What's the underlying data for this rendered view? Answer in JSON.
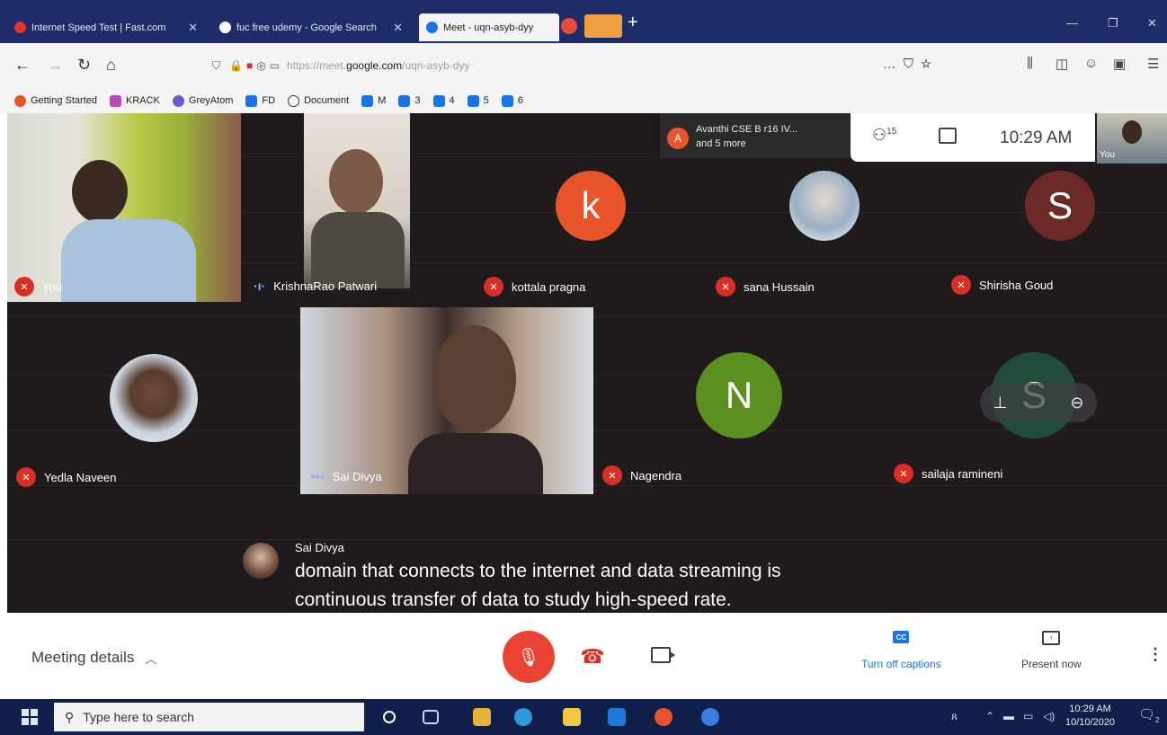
{
  "browser": {
    "tabs": [
      {
        "title": "Internet Speed Test | Fast.com",
        "active": false
      },
      {
        "title": "fuc free udemy - Google Search",
        "active": false
      },
      {
        "title": "Meet - uqn-asyb-dyy",
        "active": true
      }
    ],
    "url": {
      "protocol": "https://meet.",
      "host": "google.com",
      "path": "/uqn-asyb-dyy"
    },
    "bookmarks": [
      "Getting Started",
      "KRACK",
      "GreyAtom",
      "FD",
      "Document",
      "M",
      "3",
      "4",
      "5",
      "6"
    ]
  },
  "meet": {
    "presenter_chip": {
      "avatar_letter": "A",
      "name": "Avanthi CSE B r16 IV...",
      "more": "and 5 more"
    },
    "people_count": "15",
    "clock": "10:29 AM",
    "self_thumb_label": "You",
    "participants": [
      {
        "name": "You",
        "muted": true
      },
      {
        "name": "KrishnaRao Patwari",
        "muted": false
      },
      {
        "name": "kottala pragna",
        "muted": true,
        "avatar_letter": "k",
        "avatar_color": "#e8552b"
      },
      {
        "name": "sana Hussain",
        "muted": true
      },
      {
        "name": "Shirisha Goud",
        "muted": true,
        "avatar_letter": "S",
        "avatar_color": "#6b2a26"
      },
      {
        "name": "Yedla Naveen",
        "muted": true
      },
      {
        "name": "Sai Divya",
        "muted": false
      },
      {
        "name": "Nagendra",
        "muted": true,
        "avatar_letter": "N",
        "avatar_color": "#5b8f1f"
      },
      {
        "name": "sailaja ramineni",
        "muted": true,
        "avatar_letter": "S",
        "avatar_color": "#1f4d3a"
      }
    ],
    "caption": {
      "speaker": "Sai Divya",
      "line1": "domain that connects to the internet and data streaming is",
      "line2": "continuous transfer of data to study high-speed rate."
    },
    "bottom_bar": {
      "meeting_details": "Meeting details",
      "captions_label": "Turn off captions",
      "present_label": "Present now"
    }
  },
  "taskbar": {
    "search_placeholder": "Type here to search",
    "time": "10:29 AM",
    "date": "10/10/2020",
    "notification_count": "2"
  },
  "colors": {
    "tab_bar": "#1e2d6a",
    "meet_stage": "#1f1b1d",
    "mic_off_red": "#d93025",
    "taskbar": "#10204a"
  }
}
